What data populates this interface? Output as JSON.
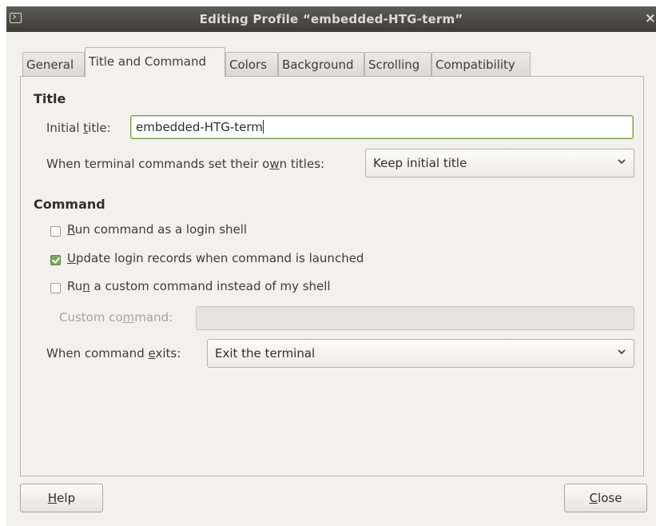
{
  "window": {
    "title": "Editing Profile “embedded-HTG-term”",
    "close_glyph": "×",
    "app_icon": "terminal-icon"
  },
  "tabs": [
    {
      "label": "General"
    },
    {
      "label": "Title and Command",
      "active": true
    },
    {
      "label": "Colors"
    },
    {
      "label": "Background"
    },
    {
      "label": "Scrolling"
    },
    {
      "label": "Compatibility"
    }
  ],
  "title_section": {
    "heading": "Title",
    "initial_title_label_pre": "Initial ",
    "initial_title_label_u": "t",
    "initial_title_label_post": "itle:",
    "initial_title_value": "embedded-HTG-term",
    "dynamic_label_pre": "When terminal commands set their o",
    "dynamic_label_u": "w",
    "dynamic_label_post": "n titles:",
    "dynamic_value": "Keep initial title"
  },
  "command_section": {
    "heading": "Command",
    "login_shell": {
      "u": "R",
      "rest": "un command as a login shell",
      "checked": false
    },
    "update_records": {
      "u": "U",
      "rest": "pdate login records when command is launched",
      "checked": true
    },
    "custom_command": {
      "pre": "Ru",
      "u": "n",
      "rest": " a custom command instead of my shell",
      "checked": false
    },
    "custom_label_pre": "Custom co",
    "custom_label_u": "m",
    "custom_label_post": "mand:",
    "custom_value": "",
    "exit_label_pre": "When command ",
    "exit_label_u": "e",
    "exit_label_post": "xits:",
    "exit_value": "Exit the terminal"
  },
  "buttons": {
    "help_u": "H",
    "help_rest": "elp",
    "close_u": "C",
    "close_rest": "lose"
  },
  "colors": {
    "titlebar": "#4a4945",
    "focus_border": "#7aa14a",
    "checkbox_checked": "#7ea859"
  }
}
